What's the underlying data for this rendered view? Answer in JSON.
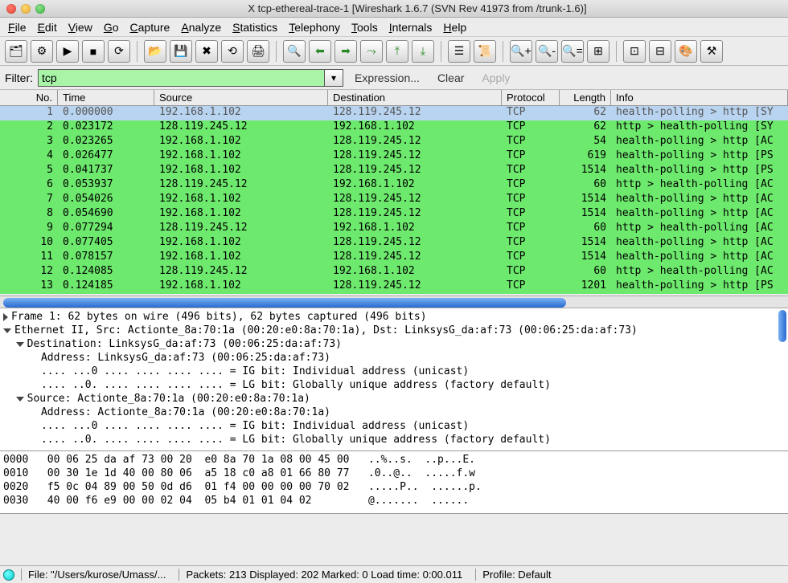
{
  "title": "tcp-ethereal-trace-1   [Wireshark 1.6.7  (SVN Rev 41973 from /trunk-1.6)]",
  "titleprefix": "X",
  "menu": [
    "File",
    "Edit",
    "View",
    "Go",
    "Capture",
    "Analyze",
    "Statistics",
    "Telephony",
    "Tools",
    "Internals",
    "Help"
  ],
  "filter": {
    "label": "Filter:",
    "value": "tcp",
    "expression": "Expression...",
    "clear": "Clear",
    "apply": "Apply"
  },
  "columns": [
    "No.",
    "Time",
    "Source",
    "Destination",
    "Protocol",
    "Length",
    "Info"
  ],
  "packets": [
    {
      "no": "1",
      "time": "0.000000",
      "src": "192.168.1.102",
      "dst": "128.119.245.12",
      "proto": "TCP",
      "len": "62",
      "info": "health-polling > http  [SY",
      "sel": true
    },
    {
      "no": "2",
      "time": "0.023172",
      "src": "128.119.245.12",
      "dst": "192.168.1.102",
      "proto": "TCP",
      "len": "62",
      "info": "http > health-polling  [SY"
    },
    {
      "no": "3",
      "time": "0.023265",
      "src": "192.168.1.102",
      "dst": "128.119.245.12",
      "proto": "TCP",
      "len": "54",
      "info": "health-polling > http  [AC"
    },
    {
      "no": "4",
      "time": "0.026477",
      "src": "192.168.1.102",
      "dst": "128.119.245.12",
      "proto": "TCP",
      "len": "619",
      "info": "health-polling > http  [PS"
    },
    {
      "no": "5",
      "time": "0.041737",
      "src": "192.168.1.102",
      "dst": "128.119.245.12",
      "proto": "TCP",
      "len": "1514",
      "info": "health-polling > http  [PS"
    },
    {
      "no": "6",
      "time": "0.053937",
      "src": "128.119.245.12",
      "dst": "192.168.1.102",
      "proto": "TCP",
      "len": "60",
      "info": "http > health-polling  [AC"
    },
    {
      "no": "7",
      "time": "0.054026",
      "src": "192.168.1.102",
      "dst": "128.119.245.12",
      "proto": "TCP",
      "len": "1514",
      "info": "health-polling > http  [AC"
    },
    {
      "no": "8",
      "time": "0.054690",
      "src": "192.168.1.102",
      "dst": "128.119.245.12",
      "proto": "TCP",
      "len": "1514",
      "info": "health-polling > http  [AC"
    },
    {
      "no": "9",
      "time": "0.077294",
      "src": "128.119.245.12",
      "dst": "192.168.1.102",
      "proto": "TCP",
      "len": "60",
      "info": "http > health-polling  [AC"
    },
    {
      "no": "10",
      "time": "0.077405",
      "src": "192.168.1.102",
      "dst": "128.119.245.12",
      "proto": "TCP",
      "len": "1514",
      "info": "health-polling > http  [AC"
    },
    {
      "no": "11",
      "time": "0.078157",
      "src": "192.168.1.102",
      "dst": "128.119.245.12",
      "proto": "TCP",
      "len": "1514",
      "info": "health-polling > http  [AC"
    },
    {
      "no": "12",
      "time": "0.124085",
      "src": "128.119.245.12",
      "dst": "192.168.1.102",
      "proto": "TCP",
      "len": "60",
      "info": "http > health-polling  [AC"
    },
    {
      "no": "13",
      "time": "0.124185",
      "src": "192.168.1.102",
      "dst": "128.119.245.12",
      "proto": "TCP",
      "len": "1201",
      "info": "health-polling > http  [PS"
    }
  ],
  "details": [
    {
      "t": "r",
      "indent": 0,
      "text": "Frame 1: 62 bytes on wire (496 bits), 62 bytes captured (496 bits)"
    },
    {
      "t": "d",
      "indent": 0,
      "text": "Ethernet II, Src: Actionte_8a:70:1a (00:20:e0:8a:70:1a), Dst: LinksysG_da:af:73 (00:06:25:da:af:73)"
    },
    {
      "t": "d",
      "indent": 1,
      "text": "Destination: LinksysG_da:af:73 (00:06:25:da:af:73)"
    },
    {
      "t": "",
      "indent": 2,
      "text": "Address: LinksysG_da:af:73 (00:06:25:da:af:73)"
    },
    {
      "t": "",
      "indent": 2,
      "text": ".... ...0 .... .... .... .... = IG bit: Individual address (unicast)"
    },
    {
      "t": "",
      "indent": 2,
      "text": ".... ..0. .... .... .... .... = LG bit: Globally unique address (factory default)"
    },
    {
      "t": "d",
      "indent": 1,
      "text": "Source: Actionte_8a:70:1a (00:20:e0:8a:70:1a)"
    },
    {
      "t": "",
      "indent": 2,
      "text": "Address: Actionte_8a:70:1a (00:20:e0:8a:70:1a)"
    },
    {
      "t": "",
      "indent": 2,
      "text": ".... ...0 .... .... .... .... = IG bit: Individual address (unicast)"
    },
    {
      "t": "",
      "indent": 2,
      "text": ".... ..0. .... .... .... .... = LG bit: Globally unique address (factory default)"
    }
  ],
  "hex": [
    "0000   00 06 25 da af 73 00 20  e0 8a 70 1a 08 00 45 00   ..%..s.  ..p...E.",
    "0010   00 30 1e 1d 40 00 80 06  a5 18 c0 a8 01 66 80 77   .0..@..  .....f.w",
    "0020   f5 0c 04 89 00 50 0d d6  01 f4 00 00 00 00 70 02   .....P..  ......p.",
    "0030   40 00 f6 e9 00 00 02 04  05 b4 01 01 04 02         @.......  ......"
  ],
  "status": {
    "file": "File: \"/Users/kurose/Umass/...",
    "packets": "Packets: 213 Displayed: 202 Marked: 0 Load time: 0:00.011",
    "profile": "Profile: Default"
  }
}
